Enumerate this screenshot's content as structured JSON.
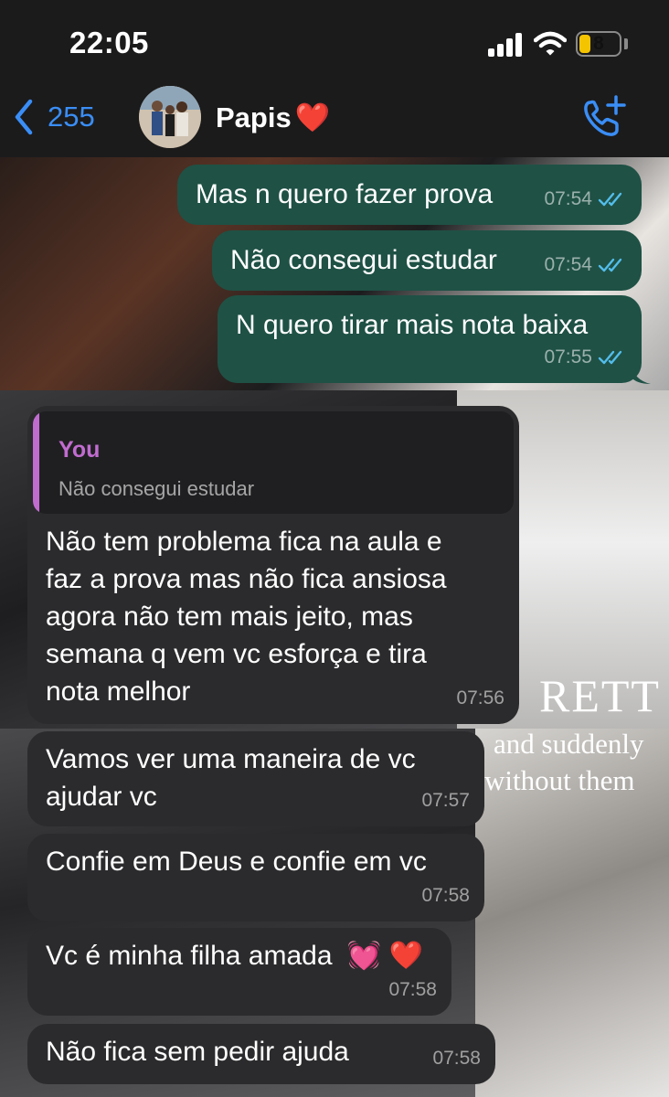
{
  "status_bar": {
    "time": "22:05",
    "battery": "8"
  },
  "header": {
    "back_count": "255",
    "contact_name": "Papis",
    "contact_emoji": "❤️"
  },
  "wallpaper_text": {
    "word_1": "RETT",
    "phrase_1": "and suddenly",
    "phrase_2": "without them"
  },
  "messages": [
    {
      "direction": "out",
      "text": "Mas n quero fazer prova",
      "time": "07:54",
      "status": "read"
    },
    {
      "direction": "out",
      "text": "Não consegui estudar",
      "time": "07:54",
      "status": "read"
    },
    {
      "direction": "out",
      "text": "N quero tirar mais nota baixa",
      "time": "07:55",
      "status": "read"
    },
    {
      "direction": "in",
      "reply_to": {
        "author": "You",
        "text": "Não consegui estudar"
      },
      "lines": [
        "Não tem problema fica na aula e",
        "faz a prova mas não fica ansiosa",
        "agora não tem mais jeito, mas",
        "semana q vem vc esforça e tira",
        "nota melhor"
      ],
      "time": "07:56"
    },
    {
      "direction": "in",
      "lines": [
        "Vamos ver uma maneira de vc",
        "ajudar vc"
      ],
      "time": "07:57"
    },
    {
      "direction": "in",
      "text": "Confie em Deus e confie em vc",
      "time": "07:58"
    },
    {
      "direction": "in",
      "text": "Vc é minha filha amada",
      "emoji": "💓 ❤️",
      "time": "07:58"
    },
    {
      "direction": "in",
      "text": "Não fica sem pedir ajuda",
      "time": "07:58"
    }
  ],
  "colors": {
    "outgoing_bubble": "#1f5145",
    "incoming_bubble": "#2b2b2d",
    "accent_blue": "#3a8ef6",
    "reply_author": "#c06ccf",
    "read_ticks": "#53bdeb"
  },
  "icons": [
    "chevron-left-icon",
    "add-call-icon",
    "cellular-signal-icon",
    "wifi-icon",
    "battery-icon",
    "double-check-icon"
  ]
}
